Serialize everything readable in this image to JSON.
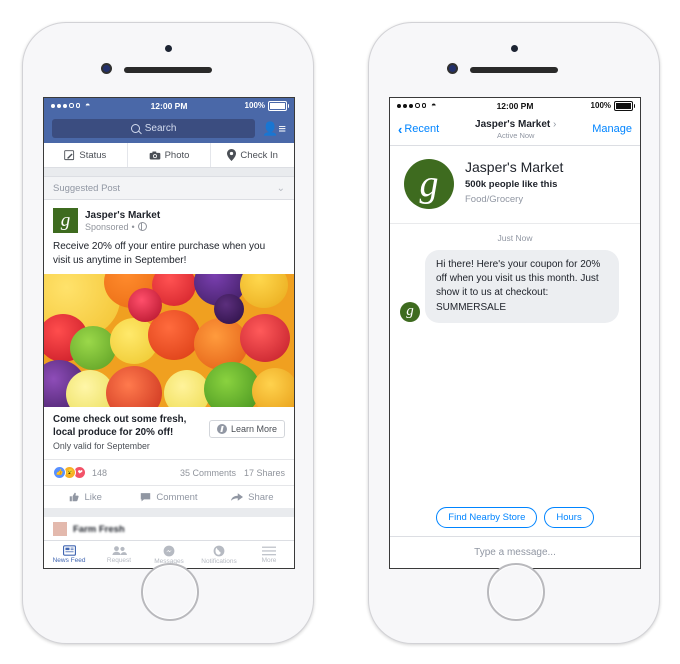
{
  "left_phone": {
    "status_bar": {
      "time": "12:00 PM",
      "battery": "100%"
    },
    "nav": {
      "search_placeholder": "Search",
      "friends_icon": "friend-requests-icon"
    },
    "composer_tabs": [
      {
        "label": "Status",
        "icon": "pencil-square-icon"
      },
      {
        "label": "Photo",
        "icon": "camera-icon"
      },
      {
        "label": "Check In",
        "icon": "location-pin-icon"
      }
    ],
    "suggested_label": "Suggested Post",
    "post": {
      "page_name": "Jasper's Market",
      "sponsored": "Sponsored",
      "privacy_icon": "globe-icon",
      "body": "Receive 20% off your entire purchase when you visit us anytime in September!",
      "link_title": "Come check out some fresh, local produce for 20% off!",
      "link_subtitle": "Only valid for September",
      "cta_label": "Learn More",
      "cta_icon": "messenger-bolt-icon",
      "reaction_count": "148",
      "comments": "35 Comments",
      "shares": "17 Shares",
      "actions": [
        {
          "label": "Like",
          "icon": "thumbs-up-icon"
        },
        {
          "label": "Comment",
          "icon": "comment-bubble-icon"
        },
        {
          "label": "Share",
          "icon": "share-arrow-icon"
        }
      ]
    },
    "tab_bar": [
      {
        "label": "News Feed",
        "icon": "news-feed-icon",
        "active": true
      },
      {
        "label": "Request",
        "icon": "friends-icon",
        "active": false
      },
      {
        "label": "Messages",
        "icon": "messenger-icon",
        "active": false
      },
      {
        "label": "Notifications",
        "icon": "globe-notifications-icon",
        "active": false
      },
      {
        "label": "More",
        "icon": "hamburger-menu-icon",
        "active": false
      }
    ]
  },
  "right_phone": {
    "status_bar": {
      "time": "12:00 PM",
      "battery": "100%"
    },
    "nav": {
      "back_label": "Recent",
      "title": "Jasper's Market",
      "title_chevron": "›",
      "subtitle": "Active Now",
      "manage_label": "Manage"
    },
    "profile": {
      "name": "Jasper's Market",
      "likes": "500k people like this",
      "category": "Food/Grocery"
    },
    "timestamp": "Just Now",
    "message": "Hi there! Here's your coupon for 20% off when you visit us this month. Just show it to us at checkout: SUMMERSALE",
    "quick_replies": [
      "Find Nearby Store",
      "Hours"
    ],
    "composer_placeholder": "Type a message..."
  },
  "colors": {
    "fb_blue": "#4a68a8",
    "fb_search": "#3b4d80",
    "brand_green": "#3e6b1f",
    "messenger_blue": "#0084ff",
    "active_tab": "#4267b2"
  }
}
